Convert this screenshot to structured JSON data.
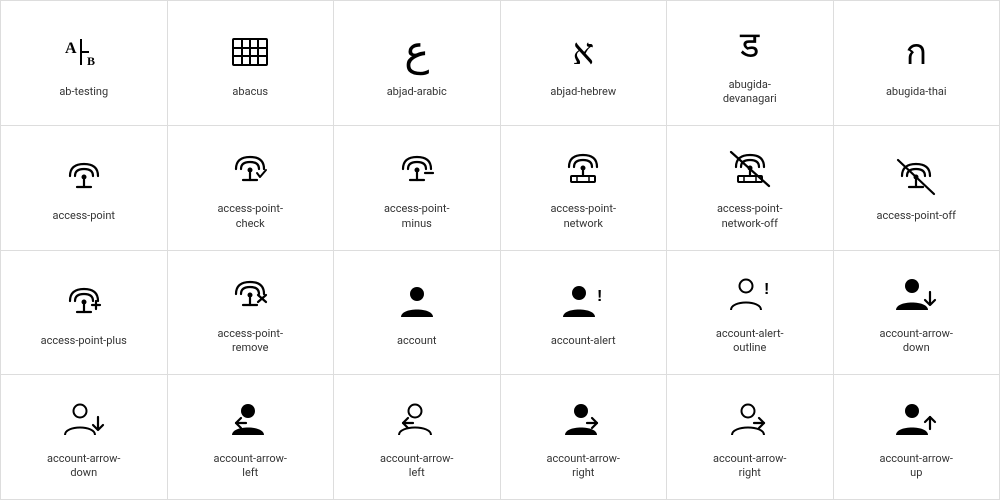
{
  "icons": [
    {
      "id": "ab-testing",
      "label": "ab-testing",
      "type": "text",
      "symbol": ""
    },
    {
      "id": "abacus",
      "label": "abacus",
      "type": "text",
      "symbol": ""
    },
    {
      "id": "abjad-arabic",
      "label": "abjad-arabic",
      "type": "text",
      "symbol": "ع"
    },
    {
      "id": "abjad-hebrew",
      "label": "abjad-hebrew",
      "type": "text",
      "symbol": ""
    },
    {
      "id": "abugida-devanagari",
      "label": "abugida-\ndevanagari",
      "type": "text",
      "symbol": ""
    },
    {
      "id": "abugida-thai",
      "label": "abugida-thai",
      "type": "text",
      "symbol": ""
    },
    {
      "id": "access-point",
      "label": "access-point",
      "type": "text",
      "symbol": ""
    },
    {
      "id": "access-point-check",
      "label": "access-point-\ncheck",
      "type": "text",
      "symbol": ""
    },
    {
      "id": "access-point-minus",
      "label": "access-point-\nminus",
      "type": "text",
      "symbol": ""
    },
    {
      "id": "access-point-network",
      "label": "access-point-\nnetwork",
      "type": "text",
      "symbol": ""
    },
    {
      "id": "access-point-network-off",
      "label": "access-point-\nnetwork-off",
      "type": "text",
      "symbol": ""
    },
    {
      "id": "access-point-off",
      "label": "access-point-off",
      "type": "text",
      "symbol": ""
    },
    {
      "id": "access-point-plus",
      "label": "access-point-plus",
      "type": "text",
      "symbol": ""
    },
    {
      "id": "access-point-remove",
      "label": "access-point-\nremove",
      "type": "text",
      "symbol": ""
    },
    {
      "id": "account",
      "label": "account",
      "type": "text",
      "symbol": ""
    },
    {
      "id": "account-alert",
      "label": "account-alert",
      "type": "text",
      "symbol": ""
    },
    {
      "id": "account-alert-outline",
      "label": "account-alert-\noutline",
      "type": "text",
      "symbol": ""
    },
    {
      "id": "account-arrow-down",
      "label": "account-arrow-\ndown",
      "type": "text",
      "symbol": ""
    },
    {
      "id": "account-arrow-down-2",
      "label": "account-arrow-\ndown",
      "type": "text",
      "symbol": ""
    },
    {
      "id": "account-arrow-left",
      "label": "account-arrow-\nleft",
      "type": "text",
      "symbol": ""
    },
    {
      "id": "account-arrow-left-2",
      "label": "account-arrow-\nleft",
      "type": "text",
      "symbol": ""
    },
    {
      "id": "account-arrow-right",
      "label": "account-arrow-\nright",
      "type": "text",
      "symbol": ""
    },
    {
      "id": "account-arrow-right-2",
      "label": "account-arrow-\nright",
      "type": "text",
      "symbol": ""
    },
    {
      "id": "account-arrow-up",
      "label": "account-arrow-\nup",
      "type": "text",
      "symbol": ""
    }
  ]
}
